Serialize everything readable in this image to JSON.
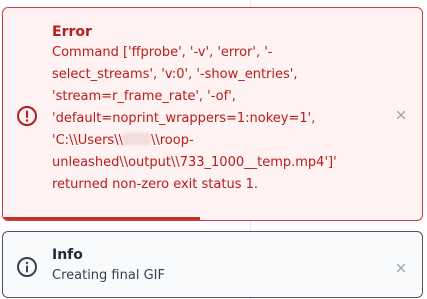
{
  "toasts": {
    "error": {
      "title": "Error",
      "message_before_redaction": "Command ['ffprobe', '-v', 'error', '-\nselect_streams', 'v:0', '-show_entries',\n'stream=r_frame_rate', '-of',\n'default=noprint_wrappers=1:nokey=1',\n'C:\\\\Users\\\\",
      "message_after_redaction": "\\\\roop-\nunleashed\\\\output\\\\733_1000__temp.mp4']'\nreturned non-zero exit status 1.",
      "icon": "alert-circle-icon",
      "close_icon": "close-icon",
      "progress": 0.47,
      "colors": {
        "accent": "#b91c1c",
        "border": "#cf3f44",
        "background": "#fef2f2"
      }
    },
    "info": {
      "title": "Info",
      "message": "Creating final GIF",
      "icon": "info-circle-icon",
      "close_icon": "close-icon",
      "colors": {
        "text": "#1f2937",
        "border": "#4c5868",
        "background": "#f9fafb"
      }
    }
  }
}
